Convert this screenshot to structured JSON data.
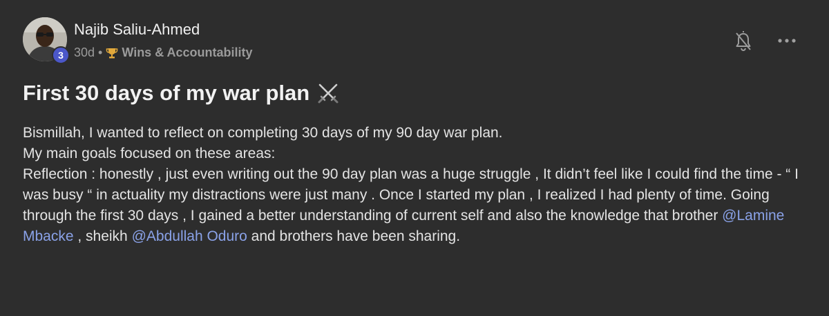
{
  "post": {
    "author": "Najib Saliu-Ahmed",
    "level": "3",
    "age": "30d",
    "separator": "•",
    "category": "Wins & Accountability",
    "title": "First 30 days of my war plan",
    "title_emoji_icon": "crossed-swords-icon",
    "paragraphs": {
      "p1": "Bismillah, I wanted to reflect on completing 30 days of my 90 day war plan.",
      "p2": "My main goals focused on these areas:",
      "p3_start": "Reflection : honestly , just even writing out the 90 day plan was a huge struggle , It didn’t feel like I could find the time - “ I was busy “ in actuality my distractions were just many . Once I started my plan , I realized I had plenty of time. Going through the first 30 days , I gained a better understanding of current self and also the knowledge that brother ",
      "mention1": "@Lamine Mbacke",
      "p3_mid": " , sheikh ",
      "mention2": "@Abdullah Oduro",
      "p3_end": " and brothers have been sharing."
    }
  },
  "icons": {
    "bell": "bell-off-icon",
    "more": "more-horizontal-icon",
    "trophy": "trophy-icon"
  },
  "colors": {
    "background": "#2d2d2d",
    "mention": "#8aa2e8",
    "level_badge": "#4b57c9",
    "trophy": "#e2a93b"
  }
}
